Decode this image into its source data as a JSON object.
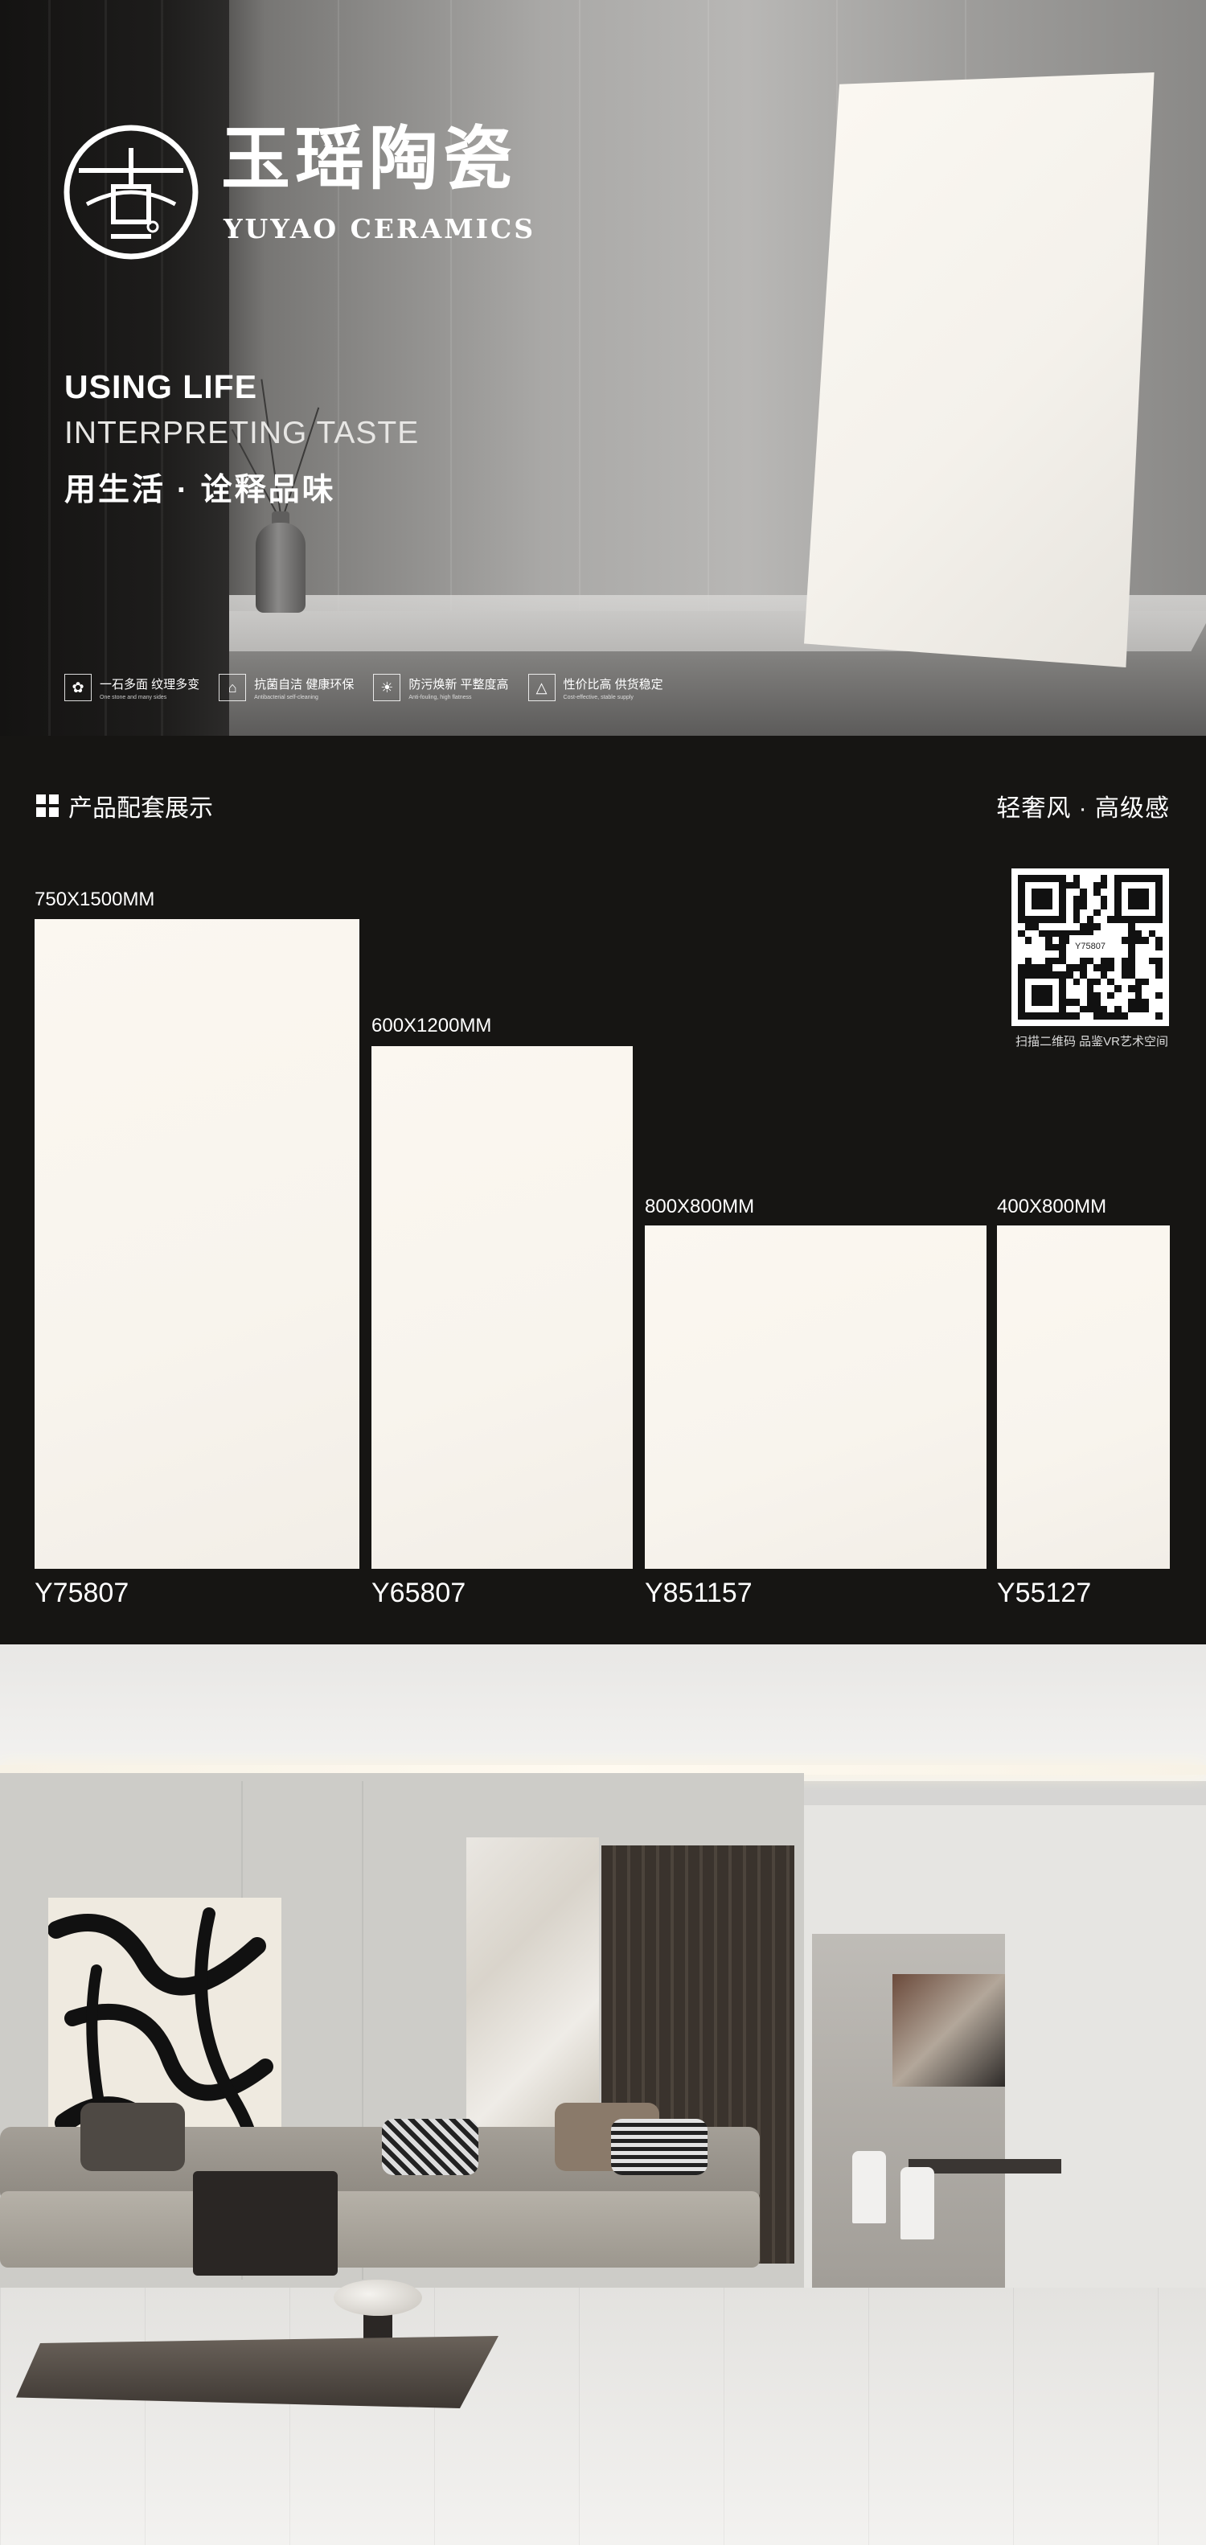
{
  "brand": {
    "name_cn": "玉瑶陶瓷",
    "name_en": "YUYAO CERAMICS",
    "logo_glyph": "卣"
  },
  "hero": {
    "tagline_1": "USING LIFE",
    "tagline_2": "INTERPRETING TASTE",
    "tagline_3": "用生活 · 诠释品味",
    "features": [
      {
        "icon": "leaf-icon",
        "title": "一石多面  纹理多变",
        "subtitle": "One stone and many sides"
      },
      {
        "icon": "house-icon",
        "title": "抗菌自洁  健康环保",
        "subtitle": "Antibacterial self-cleaning"
      },
      {
        "icon": "sun-icon",
        "title": "防污焕新  平整度高",
        "subtitle": "Anti-fouling, high flatness"
      },
      {
        "icon": "triangle-icon",
        "title": "性价比高  供货稳定",
        "subtitle": "Cost-effective, stable supply"
      }
    ]
  },
  "products": {
    "section_title": "产品配套展示",
    "section_right": "轻奢风 · 高级感",
    "qr": {
      "code": "Y75807",
      "caption": "扫描二维码 品鉴VR艺术空间"
    },
    "items": [
      {
        "size": "750X1500MM",
        "code": "Y75807"
      },
      {
        "size": "600X1200MM",
        "code": "Y65807"
      },
      {
        "size": "800X800MM",
        "code": "Y851157"
      },
      {
        "size": "400X800MM",
        "code": "Y55127"
      }
    ]
  }
}
